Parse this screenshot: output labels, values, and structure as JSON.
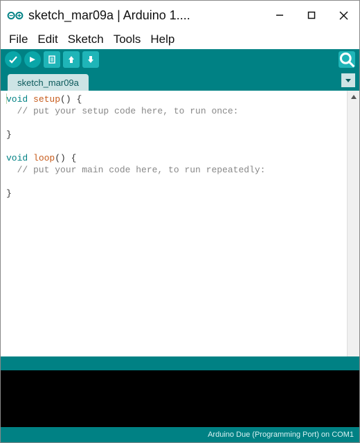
{
  "window": {
    "title": "sketch_mar09a | Arduino 1...."
  },
  "menubar": {
    "items": [
      "File",
      "Edit",
      "Sketch",
      "Tools",
      "Help"
    ]
  },
  "tabs": {
    "active": "sketch_mar09a"
  },
  "code": {
    "kw_void1": "void",
    "fn_setup": "setup",
    "setup_sig": "() {",
    "setup_comment": "  // put your setup code here, to run once:",
    "close1": "}",
    "kw_void2": "void",
    "fn_loop": "loop",
    "loop_sig": "() {",
    "loop_comment": "  // put your main code here, to run repeatedly:",
    "close2": "}"
  },
  "footer": {
    "board": "Arduino Due (Programming Port) on COM1"
  },
  "colors": {
    "teal": "#008184",
    "keyword": "#008184",
    "function": "#c75b1b",
    "comment": "#888888"
  }
}
